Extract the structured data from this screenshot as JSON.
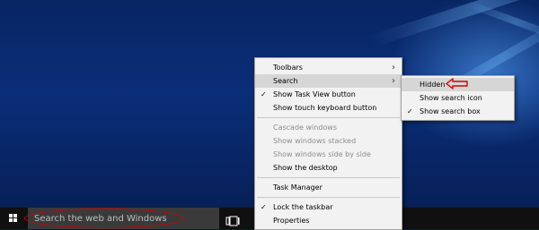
{
  "taskbar": {
    "search_placeholder": "Search the web and Windows"
  },
  "context_menu": {
    "items": [
      {
        "label": "Toolbars",
        "has_submenu": true
      },
      {
        "label": "Search",
        "has_submenu": true,
        "highlighted": true
      },
      {
        "label": "Show Task View button",
        "checked": true
      },
      {
        "label": "Show touch keyboard button"
      },
      {
        "label": "Cascade windows",
        "disabled": true
      },
      {
        "label": "Show windows stacked",
        "disabled": true
      },
      {
        "label": "Show windows side by side",
        "disabled": true
      },
      {
        "label": "Show the desktop"
      },
      {
        "label": "Task Manager"
      },
      {
        "label": "Lock the taskbar",
        "checked": true
      },
      {
        "label": "Properties"
      }
    ]
  },
  "search_submenu": {
    "items": [
      {
        "label": "Hidden",
        "highlighted": true
      },
      {
        "label": "Show search icon"
      },
      {
        "label": "Show search box",
        "checked": true
      }
    ]
  },
  "glyphs": {
    "check": "✓",
    "submenu_arrow": "›"
  },
  "colors": {
    "annotation_red": "#d40000",
    "taskbar": "#101010",
    "menu_bg": "#f2f2f2",
    "menu_highlight": "#d6d6d6"
  },
  "icons": [
    "windows-logo-icon",
    "task-view-icon",
    "checkmark-icon",
    "chevron-right-icon",
    "red-arrow-annotation-icon"
  ]
}
